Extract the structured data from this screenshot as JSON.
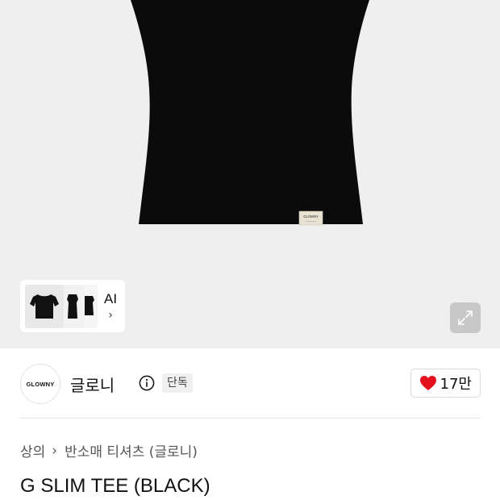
{
  "product_image": {
    "tag_text": "GLOWNY",
    "ai_card": {
      "label": "AI",
      "chevron": "›"
    },
    "expand_icon": "expand-arrows-icon"
  },
  "brand": {
    "logo_text": "GLOWNY",
    "name": "글로니",
    "badge": "단독",
    "like_count": "17만",
    "like_color": "#e5101e"
  },
  "breadcrumb": {
    "items": [
      "상의",
      "반소매 티셔츠 (글로니)"
    ],
    "separator": "›"
  },
  "product": {
    "title": "G SLIM TEE (BLACK)"
  }
}
